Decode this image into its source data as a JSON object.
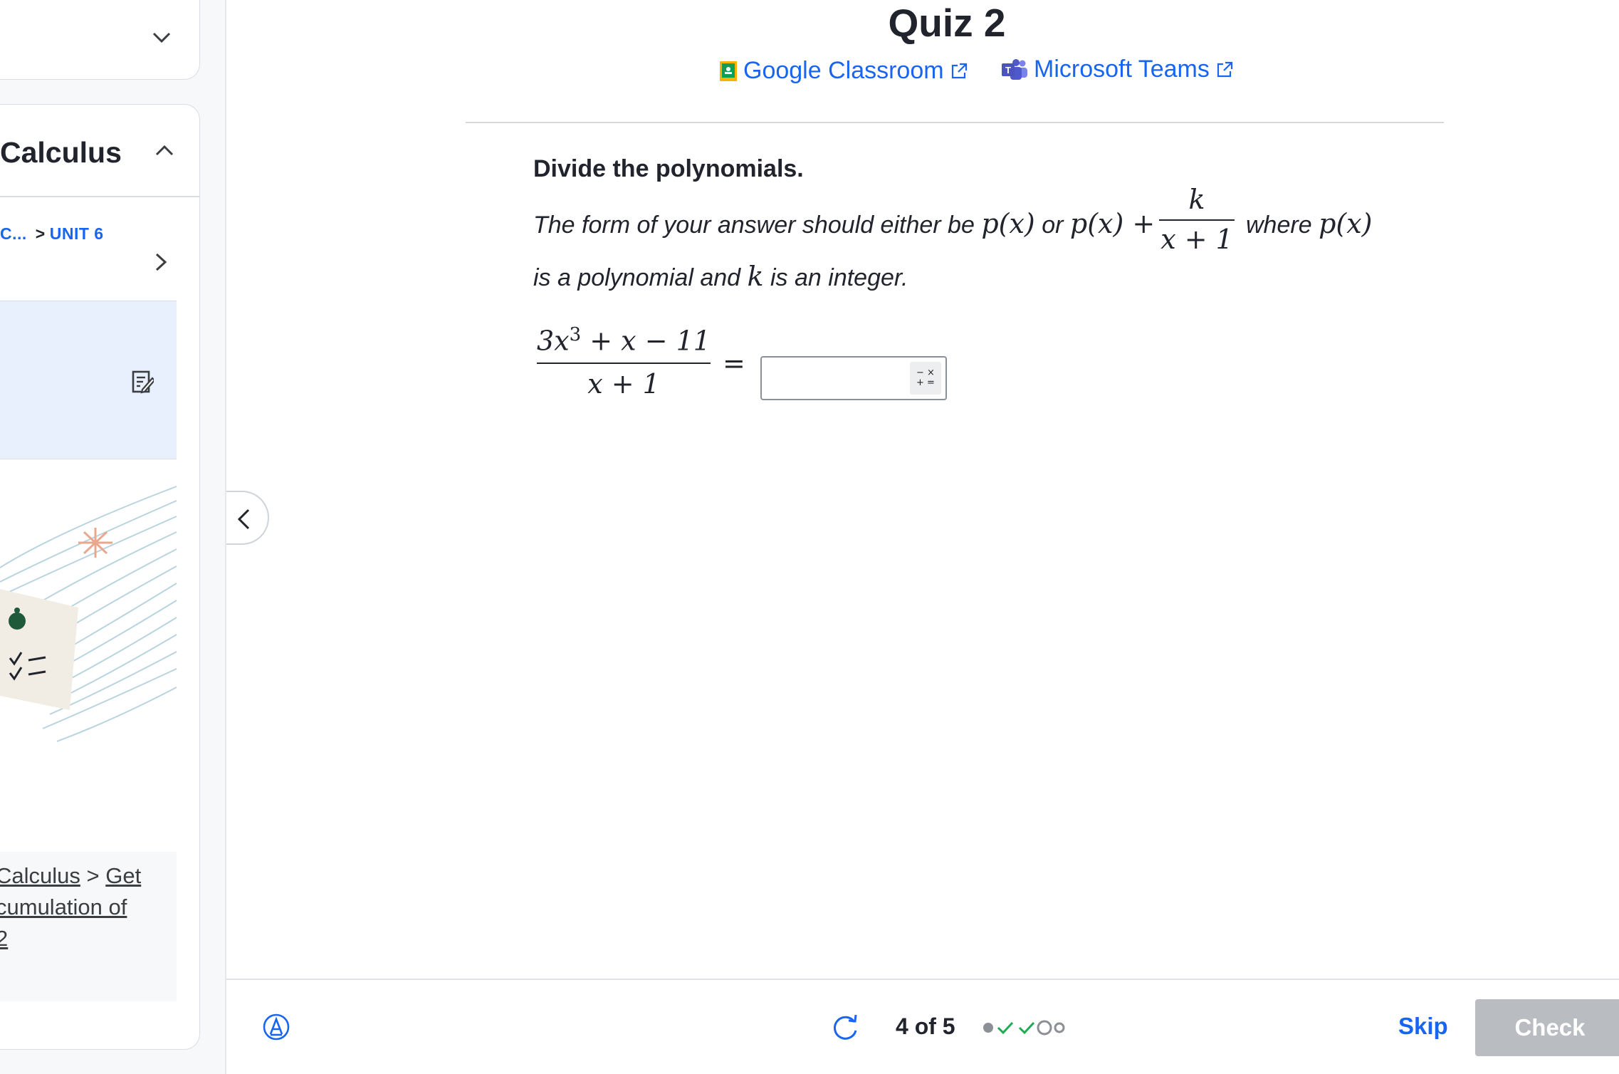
{
  "sidebar": {
    "course_title": "Calculus",
    "breadcrumb_prev": "C...",
    "breadcrumb_separator": ">",
    "breadcrumb_unit": "UNIT 6",
    "crumb_box": {
      "line1_link_a": "Calculus",
      "line1_sep": ">",
      "line1_link_b": "Get",
      "line2_link": "cumulation of",
      "line3_link": "2"
    }
  },
  "quiz": {
    "title": "Quiz 2",
    "share": {
      "google_classroom": "Google Classroom",
      "microsoft_teams": "Microsoft Teams"
    },
    "prompt": "Divide the polynomials.",
    "instruction_line1": {
      "lead": "The form of your answer should either be",
      "p_of_x": "p(x)",
      "or": "or",
      "p_plus": "p(x) +",
      "frac_num": "k",
      "frac_den": "x + 1",
      "where": "where",
      "p_of_x_2": "p(x)"
    },
    "instruction_line2": {
      "lead": "is a polynomial and",
      "k": "k",
      "tail": "is an integer."
    },
    "expression": {
      "numerator_lead": "3x",
      "numerator_exp": "3",
      "numerator_tail": "+ x − 11",
      "denominator": "x + 1",
      "equals": "="
    },
    "answer_value": "",
    "keypad_toggle": "− ×\n+ ="
  },
  "footer": {
    "progress_text": "4 of 5",
    "progress_states": [
      "answered",
      "correct",
      "correct",
      "current",
      "upcoming"
    ],
    "skip_label": "Skip",
    "check_label": "Check"
  },
  "colors": {
    "link_blue": "#1865f2",
    "check_green": "#1fab54",
    "disabled_gray": "#b9bcc1",
    "active_panel": "#e8f0fd"
  }
}
